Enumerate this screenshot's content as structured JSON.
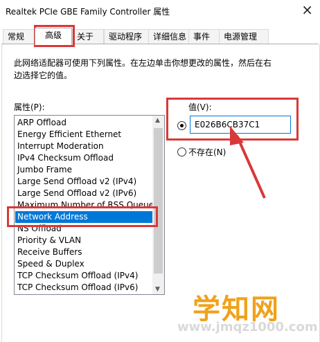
{
  "window": {
    "title": "Realtek PCIe GBE Family Controller 属性",
    "close_glyph": "×"
  },
  "tabs": [
    {
      "label": "常规",
      "active": false
    },
    {
      "label": "高级",
      "active": true
    },
    {
      "label": "关于",
      "active": false
    },
    {
      "label": "驱动程序",
      "active": false
    },
    {
      "label": "详细信息",
      "active": false
    },
    {
      "label": "事件",
      "active": false
    },
    {
      "label": "电源管理",
      "active": false
    }
  ],
  "description": "此网络适配器可使用下列属性。在左边单击你想更改的属性，然后在右边选择它的值。",
  "properties": {
    "label": "属性(P):",
    "items": [
      "ARP Offload",
      "Energy Efficient Ethernet",
      "Interrupt Moderation",
      "IPv4 Checksum Offload",
      "Jumbo Frame",
      "Large Send Offload v2 (IPv4)",
      "Large Send Offload v2 (IPv6)",
      "Maximum Number of RSS Queue",
      "Network Address",
      "NS Offload",
      "Priority & VLAN",
      "Receive Buffers",
      "Speed & Duplex",
      "TCP Checksum Offload (IPv4)",
      "TCP Checksum Offload (IPv6)"
    ],
    "selected_index": 8
  },
  "value": {
    "label": "值(V):",
    "input_value": "E026B6CB37C1",
    "not_present_label": "不存在(N)",
    "value_selected": true
  },
  "watermark": {
    "big": "学知网",
    "small": "www.jmqz1000.com"
  },
  "colors": {
    "highlight": "#0078d7",
    "annotation_red": "#d93838",
    "watermark_orange": "#f0a21b"
  }
}
